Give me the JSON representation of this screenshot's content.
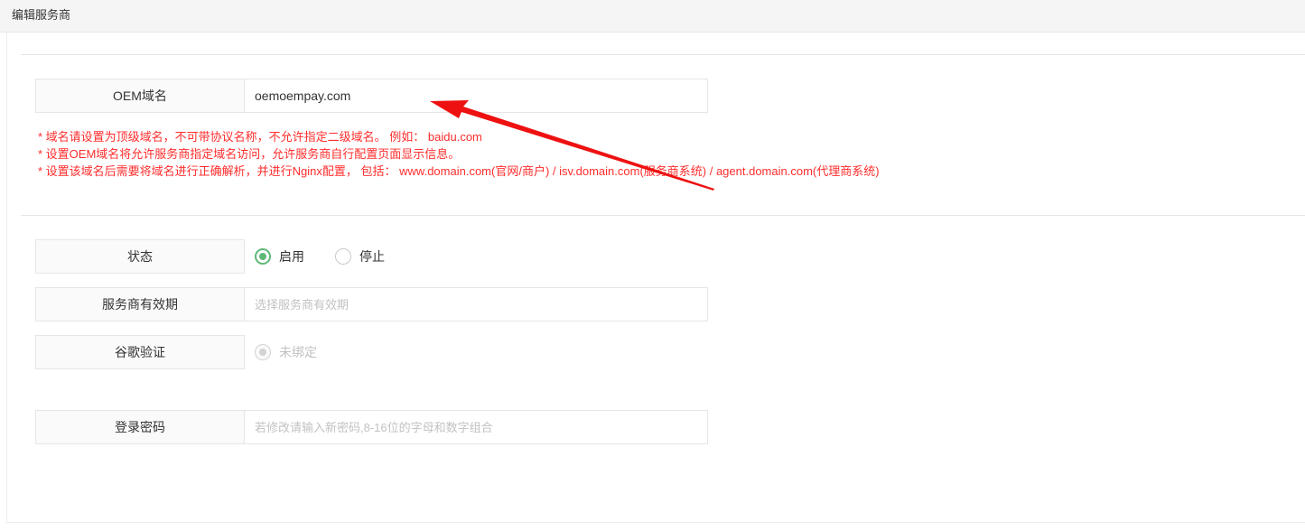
{
  "header": {
    "title": "编辑服务商"
  },
  "oem": {
    "label": "OEM域名",
    "value": "oemoempay.com",
    "notes": [
      "* 域名请设置为顶级域名，不可带协议名称，不允许指定二级域名。 例如： baidu.com",
      "* 设置OEM域名将允许服务商指定域名访问，允许服务商自行配置页面显示信息。",
      "* 设置该域名后需要将域名进行正确解析，并进行Nginx配置， 包括： www.domain.com(官网/商户) / isv.domain.com(服务商系统) / agent.domain.com(代理商系统)"
    ]
  },
  "status": {
    "label": "状态",
    "options": [
      "启用",
      "停止"
    ],
    "selected": "启用"
  },
  "validity": {
    "label": "服务商有效期",
    "placeholder": "选择服务商有效期"
  },
  "google_auth": {
    "label": "谷歌验证",
    "option": "未绑定"
  },
  "password": {
    "label": "登录密码",
    "placeholder": "若修改请输入新密码,8-16位的字母和数字组合"
  },
  "colors": {
    "accent_green": "#5fb878",
    "note_red": "#ff2d2d",
    "annotation_arrow": "#ee1111"
  }
}
